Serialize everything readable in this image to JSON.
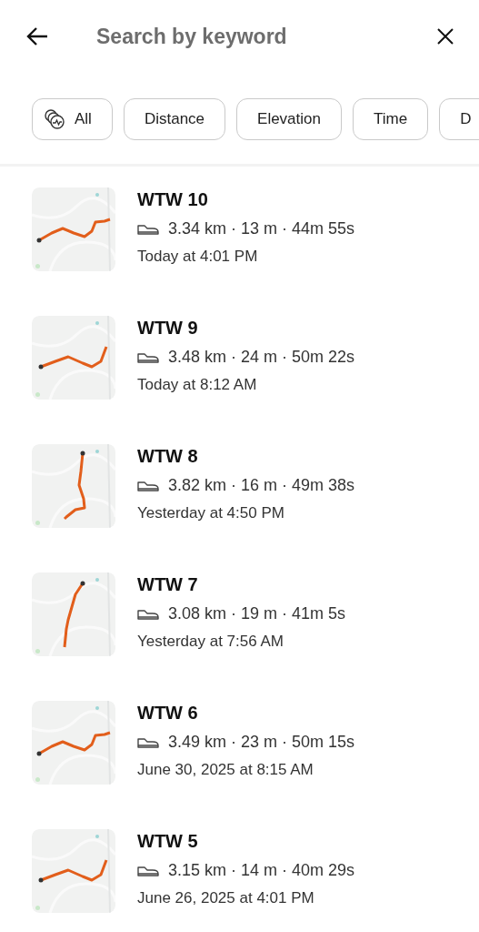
{
  "search": {
    "placeholder": "Search by keyword"
  },
  "filters": [
    {
      "label": "All",
      "kind": "icon"
    },
    {
      "label": "Distance",
      "kind": "plain"
    },
    {
      "label": "Elevation",
      "kind": "plain"
    },
    {
      "label": "Time",
      "kind": "plain"
    },
    {
      "label": "D",
      "kind": "plain"
    }
  ],
  "activities": [
    {
      "title": "WTW 10",
      "stats": "3.34 km · 13 m · 44m 55s",
      "date": "Today at 4:01 PM"
    },
    {
      "title": "WTW 9",
      "stats": "3.48 km · 24 m · 50m 22s",
      "date": "Today at 8:12 AM"
    },
    {
      "title": "WTW 8",
      "stats": "3.82 km · 16 m · 49m 38s",
      "date": "Yesterday at 4:50 PM"
    },
    {
      "title": "WTW 7",
      "stats": "3.08 km · 19 m · 41m 5s",
      "date": "Yesterday at 7:56 AM"
    },
    {
      "title": "WTW 6",
      "stats": "3.49 km · 23 m · 50m 15s",
      "date": "June 30, 2025 at 8:15 AM"
    },
    {
      "title": "WTW 5",
      "stats": "3.15 km · 14 m · 40m 29s",
      "date": "June 26, 2025 at 4:01 PM"
    }
  ]
}
